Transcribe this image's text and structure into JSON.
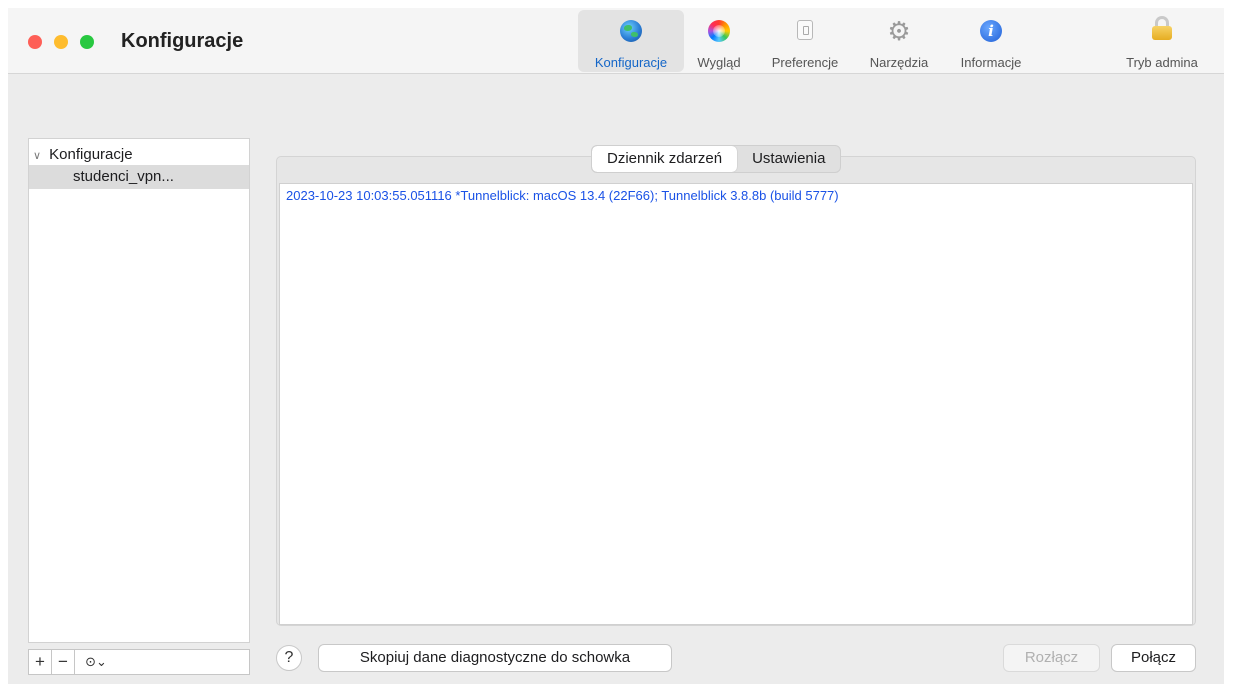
{
  "window": {
    "title": "Konfiguracje"
  },
  "toolbar": {
    "items": [
      {
        "label": "Konfiguracje",
        "icon": "globe-icon",
        "active": true
      },
      {
        "label": "Wygląd",
        "icon": "color-wheel-icon",
        "active": false
      },
      {
        "label": "Preferencje",
        "icon": "switch-icon",
        "active": false
      },
      {
        "label": "Narzędzia",
        "icon": "gear-icon",
        "active": false
      },
      {
        "label": "Informacje",
        "icon": "info-icon",
        "active": false
      }
    ],
    "admin": {
      "label": "Tryb admina",
      "icon": "lock-icon"
    }
  },
  "sidebar": {
    "header": "Konfiguracje",
    "items": [
      {
        "label": "studenci_vpn...",
        "selected": true
      }
    ],
    "buttons": {
      "add": "+",
      "remove": "−",
      "more": "⊙⌄"
    }
  },
  "tabs": [
    {
      "label": "Dziennik zdarzeń",
      "active": true
    },
    {
      "label": "Ustawienia",
      "active": false
    }
  ],
  "log": {
    "lines": [
      "2023-10-23 10:03:55.051116 *Tunnelblick: macOS 13.4 (22F66); Tunnelblick 3.8.8b (build 5777)"
    ],
    "text_color": "#1a52e6"
  },
  "footer": {
    "help": "?",
    "copy_label": "Skopiuj dane diagnostyczne do schowka",
    "disconnect_label": "Rozłącz",
    "connect_label": "Połącz"
  },
  "colors": {
    "accent": "#1466c8",
    "close": "#fe5f57",
    "minimize": "#febc2e",
    "zoom": "#28c840"
  }
}
